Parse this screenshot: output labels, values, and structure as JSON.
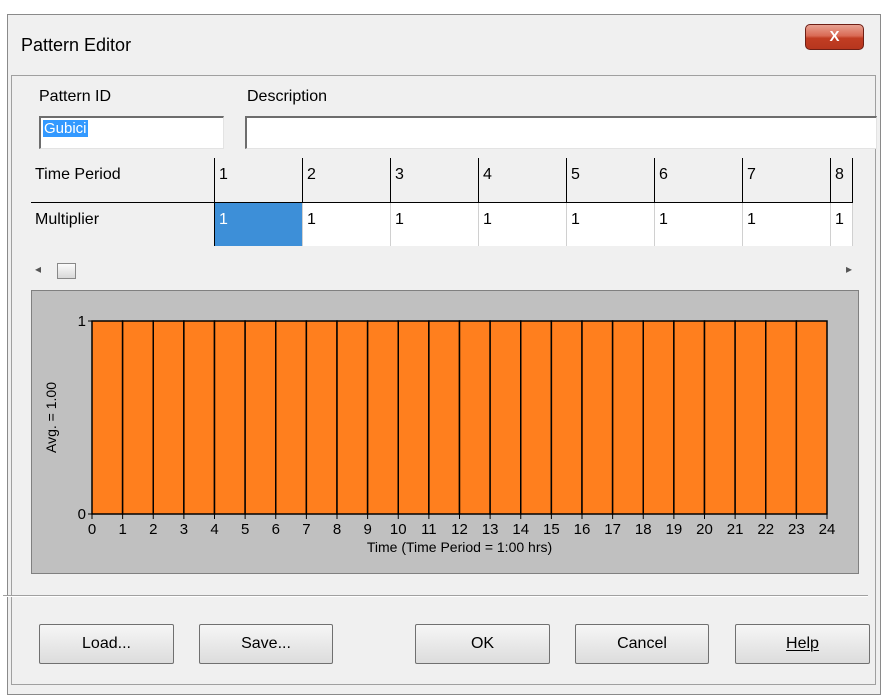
{
  "window": {
    "title": "Pattern Editor",
    "close_glyph": "X"
  },
  "pattern_id": {
    "label": "Pattern ID",
    "value": "Gubici"
  },
  "description": {
    "label": "Description",
    "value": ""
  },
  "grid": {
    "row_headers": [
      "Time Period",
      "Multiplier"
    ],
    "periods": [
      "1",
      "2",
      "3",
      "4",
      "5",
      "6",
      "7",
      "8"
    ],
    "multipliers": [
      "1",
      "1",
      "1",
      "1",
      "1",
      "1",
      "1",
      "1"
    ]
  },
  "scrollbar": {
    "left_arrow": "◂",
    "right_arrow": "▸"
  },
  "chart_data": {
    "type": "bar",
    "categories": [
      "0",
      "1",
      "2",
      "3",
      "4",
      "5",
      "6",
      "7",
      "8",
      "9",
      "10",
      "11",
      "12",
      "13",
      "14",
      "15",
      "16",
      "17",
      "18",
      "19",
      "20",
      "21",
      "22",
      "23"
    ],
    "values": [
      1,
      1,
      1,
      1,
      1,
      1,
      1,
      1,
      1,
      1,
      1,
      1,
      1,
      1,
      1,
      1,
      1,
      1,
      1,
      1,
      1,
      1,
      1,
      1
    ],
    "x_ticks": [
      "0",
      "1",
      "2",
      "3",
      "4",
      "5",
      "6",
      "7",
      "8",
      "9",
      "10",
      "11",
      "12",
      "13",
      "14",
      "15",
      "16",
      "17",
      "18",
      "19",
      "20",
      "21",
      "22",
      "23",
      "24"
    ],
    "y_ticks": [
      "0",
      "1"
    ],
    "ylim": [
      0,
      1
    ],
    "xlim": [
      0,
      24
    ],
    "xlabel": "Time (Time Period = 1:00 hrs)",
    "ylabel": "Avg. = 1.00",
    "title": "",
    "bar_color": "#ff7f1e",
    "background_color": "#c0c0c0"
  },
  "buttons": {
    "load": "Load...",
    "save": "Save...",
    "ok": "OK",
    "cancel": "Cancel",
    "help": "Help"
  }
}
